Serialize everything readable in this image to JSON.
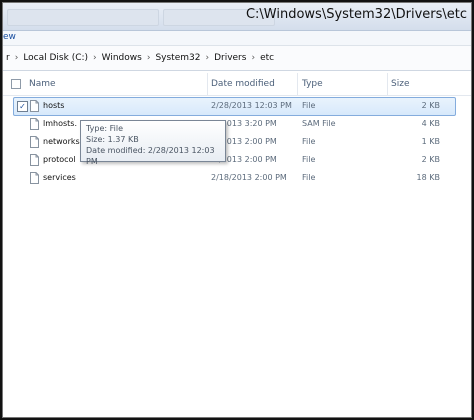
{
  "window": {
    "title": "C:\\Windows\\System32\\Drivers\\etc",
    "menu_view": "ew"
  },
  "address": {
    "leading": "r",
    "crumbs": [
      "Local Disk (C:)",
      "Windows",
      "System32",
      "Drivers",
      "etc"
    ]
  },
  "columns": {
    "name": "Name",
    "date": "Date modified",
    "type": "Type",
    "size": "Size"
  },
  "files": [
    {
      "name": "hosts",
      "date": "2/28/2013 12:03 PM",
      "type": "File",
      "size": "2 KB",
      "selected": true
    },
    {
      "name": "lmhosts.",
      "date": "/2013 3:20 PM",
      "type": "SAM File",
      "size": "4 KB"
    },
    {
      "name": "networks",
      "date": "/2013 2:00 PM",
      "type": "File",
      "size": "1 KB"
    },
    {
      "name": "protocol",
      "date": "/2013 2:00 PM",
      "type": "File",
      "size": "2 KB"
    },
    {
      "name": "services",
      "date": "2/18/2013 2:00 PM",
      "type": "File",
      "size": "18 KB"
    }
  ],
  "tooltip": {
    "type_line": "Type: File",
    "size_line": "Size: 1.37 KB",
    "date_line": "Date modified: 2/28/2013 12:03 PM"
  },
  "colors": {
    "selection_border": "#84acdd",
    "selection_fill": "#d7e9fb",
    "header_text": "#4c607a"
  },
  "icons": {
    "file": "document-icon",
    "checkbox": "checkbox-icon",
    "breadcrumb_separator": "chevron-right-icon"
  }
}
